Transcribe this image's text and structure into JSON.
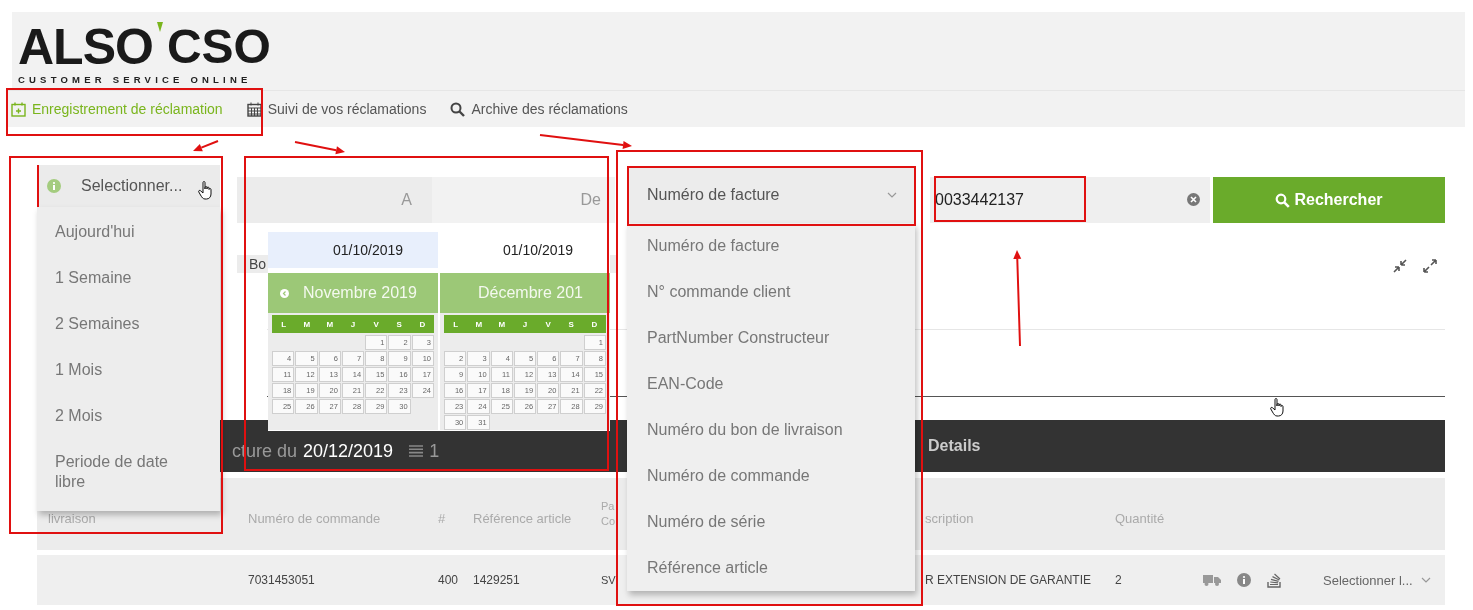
{
  "logo": {
    "brand": "ALSO",
    "product": "CSO",
    "tagline": "CUSTOMER SERVICE ONLINE"
  },
  "nav": [
    {
      "label": "Enregistrement de réclamation",
      "kind": "add",
      "selected": true
    },
    {
      "label": "Suivi de vos réclamations",
      "kind": "calendar",
      "selected": false
    },
    {
      "label": "Archive des réclamations",
      "kind": "search",
      "selected": false
    }
  ],
  "date_filter": {
    "value": "Selectionner...",
    "options": [
      "Aujourd'hui",
      "1 Semaine",
      "2 Semaines",
      "1 Mois",
      "2 Mois",
      "Periode de date libre"
    ]
  },
  "date_columns": [
    "A",
    "De"
  ],
  "calendar": {
    "inputs": [
      {
        "value": "01/10/2019",
        "focused": true
      },
      {
        "value": "01/10/2019",
        "focused": false
      }
    ],
    "months": [
      {
        "title": "Novembre 2019",
        "prev": true,
        "weekdays": [
          "L",
          "M",
          "M",
          "J",
          "V",
          "S",
          "D"
        ],
        "weeks": [
          {
            "days": [
              "1",
              "2",
              "3"
            ],
            "right_aligned": true
          },
          {
            "days": [
              "4",
              "5",
              "6",
              "7",
              "8",
              "9",
              "10"
            ]
          },
          {
            "days": [
              "11",
              "12",
              "13",
              "14",
              "15",
              "16",
              "17"
            ]
          },
          {
            "days": [
              "18",
              "19",
              "20",
              "21",
              "22",
              "23",
              "24"
            ]
          },
          {
            "days": [
              "25",
              "26",
              "27",
              "28",
              "29",
              "30"
            ],
            "right_aligned": false
          }
        ]
      },
      {
        "title": "Décembre 201",
        "prev": false,
        "weekdays": [
          "L",
          "M",
          "M",
          "J",
          "V",
          "S",
          "D"
        ],
        "weeks": [
          {
            "days": [
              "1"
            ],
            "right_aligned": true
          },
          {
            "days": [
              "2",
              "3",
              "4",
              "5",
              "6",
              "7",
              "8"
            ]
          },
          {
            "days": [
              "9",
              "10",
              "11",
              "12",
              "13",
              "14",
              "15"
            ]
          },
          {
            "days": [
              "16",
              "17",
              "18",
              "19",
              "20",
              "21",
              "22"
            ]
          },
          {
            "days": [
              "23",
              "24",
              "25",
              "26",
              "27",
              "28",
              "29"
            ]
          },
          {
            "days": [
              "30",
              "31"
            ],
            "right_aligned": false
          }
        ]
      }
    ]
  },
  "search_type": {
    "value": "Numéro de facture",
    "options": [
      "Numéro de facture",
      "N° commande client",
      "PartNumber Constructeur",
      "EAN-Code",
      "Numéro du bon de livraison",
      "Numéro de commande",
      "Numéro de série",
      "Référence article"
    ]
  },
  "search_input": {
    "value": "0033442137"
  },
  "search_button": "Rechercher",
  "tab_label": "Bo",
  "invoice_bar": {
    "label": "cture du",
    "date": "20/12/2019",
    "count": "1",
    "details": "Details"
  },
  "table": {
    "columns": [
      "livraison",
      "Numéro de commande",
      "#",
      "Référence article",
      "Pa Co",
      "scription",
      "Quantité"
    ],
    "rows": [
      {
        "cells": [
          null,
          "7031453051",
          "400",
          "1429251",
          "SV",
          "R EXTENSION DE GARANTIE",
          "2"
        ],
        "action": "Selectionner l..."
      }
    ]
  }
}
